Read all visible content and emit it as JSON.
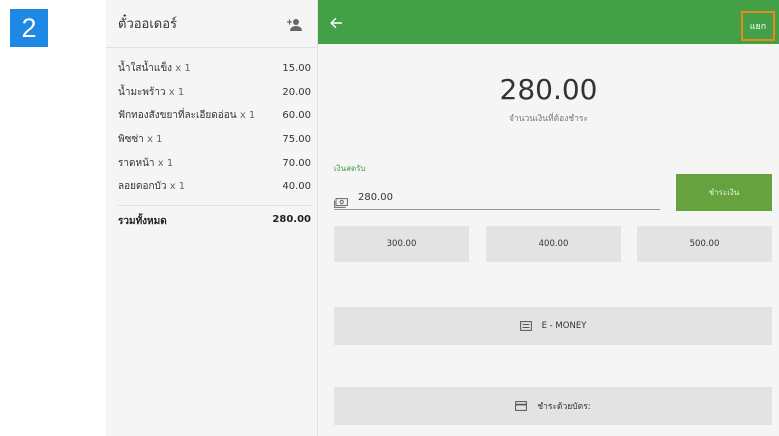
{
  "step_badge": "2",
  "order_panel": {
    "title": "ตั๋วออเดอร์",
    "items": [
      {
        "name": "น้ำใสน้ำแข็ง",
        "qty": "x 1",
        "price": "15.00"
      },
      {
        "name": "น้ำมะพร้าว",
        "qty": "x 1",
        "price": "20.00"
      },
      {
        "name": "ฟักทองสังขยาที่ละเอียดอ่อน",
        "qty": "x 1",
        "price": "60.00"
      },
      {
        "name": "พิซซ่า",
        "qty": "x 1",
        "price": "75.00"
      },
      {
        "name": "ราดหน้า",
        "qty": "x 1",
        "price": "70.00"
      },
      {
        "name": "ลอยดอกบัว",
        "qty": "x 1",
        "price": "40.00"
      }
    ],
    "total_label": "รวมทั้งหมด",
    "total_value": "280.00"
  },
  "payment": {
    "split_label": "แยก",
    "amount": "280.00",
    "amount_label": "จำนวนเงินที่ต้องชำระ",
    "cash_label": "เงินสดรับ",
    "cash_value": "280.00",
    "pay_label": "ชำระเงิน",
    "quick_amounts": [
      "300.00",
      "400.00",
      "500.00"
    ],
    "emoney_label": "E - MONEY",
    "card_label": "ชำระด้วยบัตร:"
  },
  "colors": {
    "accent": "#43a047",
    "badge": "#1e88e5",
    "highlight": "#e68a1f"
  }
}
